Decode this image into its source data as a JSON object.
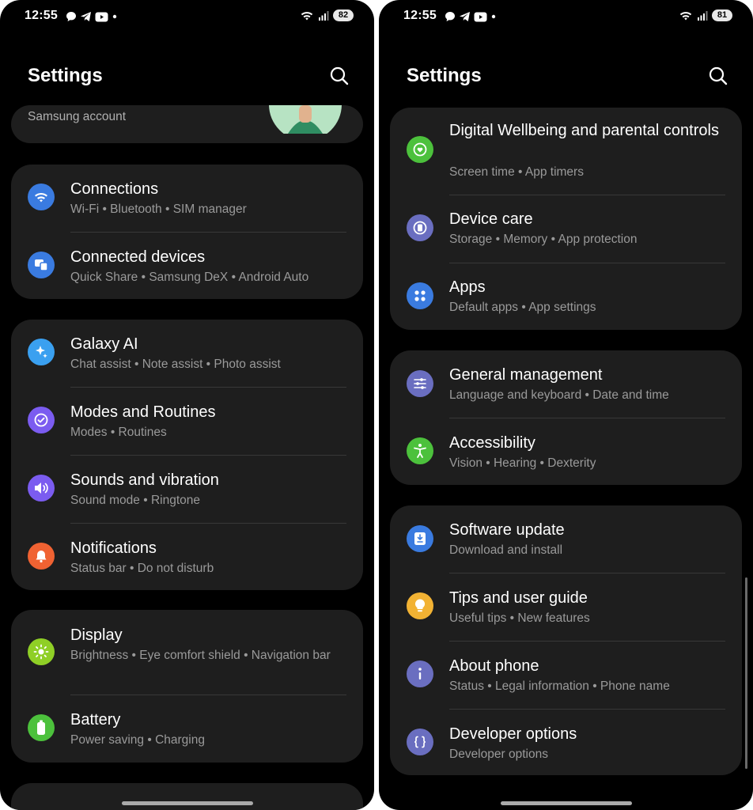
{
  "left": {
    "status": {
      "time": "12:55",
      "battery": "82"
    },
    "title": "Settings",
    "account": {
      "label": "Samsung account"
    },
    "group1": [
      {
        "title": "Connections",
        "subtitle": "Wi-Fi  •  Bluetooth  •  SIM manager",
        "icon": "wifi-icon",
        "color": "#3a7be0"
      },
      {
        "title": "Connected devices",
        "subtitle": "Quick Share  •  Samsung DeX  •  Android Auto",
        "icon": "connected-devices-icon",
        "color": "#3a7be0"
      }
    ],
    "group2": [
      {
        "title": "Galaxy AI",
        "subtitle": "Chat assist  •  Note assist  •  Photo assist",
        "icon": "sparkle-icon",
        "color": "#3aa0f0"
      },
      {
        "title": "Modes and Routines",
        "subtitle": "Modes  •  Routines",
        "icon": "routine-check-icon",
        "color": "#7b5cf0"
      },
      {
        "title": "Sounds and vibration",
        "subtitle": "Sound mode  •  Ringtone",
        "icon": "speaker-icon",
        "color": "#7b5cf0"
      },
      {
        "title": "Notifications",
        "subtitle": "Status bar  •  Do not disturb",
        "icon": "bell-icon",
        "color": "#f06232"
      }
    ],
    "group3": [
      {
        "title": "Display",
        "subtitle": "Brightness  •  Eye comfort shield  •  Navigation bar",
        "icon": "sun-icon",
        "color": "#8fcf26"
      },
      {
        "title": "Battery",
        "subtitle": "Power saving  •  Charging",
        "icon": "battery-icon",
        "color": "#4cc13c"
      }
    ]
  },
  "right": {
    "status": {
      "time": "12:55",
      "battery": "81"
    },
    "title": "Settings",
    "group1": [
      {
        "title": "Digital Wellbeing and parental controls",
        "subtitle": "Screen time  •  App timers",
        "icon": "wellbeing-heart-icon",
        "color": "#4cc13c"
      },
      {
        "title": "Device care",
        "subtitle": "Storage  •  Memory  •  App protection",
        "icon": "device-care-icon",
        "color": "#6a6ec0"
      },
      {
        "title": "Apps",
        "subtitle": "Default apps  •  App settings",
        "icon": "apps-grid-icon",
        "color": "#3a7be0"
      }
    ],
    "group2": [
      {
        "title": "General management",
        "subtitle": "Language and keyboard  •  Date and time",
        "icon": "sliders-icon",
        "color": "#6a6ec0"
      },
      {
        "title": "Accessibility",
        "subtitle": "Vision  •  Hearing  •  Dexterity",
        "icon": "accessibility-icon",
        "color": "#4cc13c"
      }
    ],
    "group3": [
      {
        "title": "Software update",
        "subtitle": "Download and install",
        "icon": "software-update-icon",
        "color": "#3a7be0"
      },
      {
        "title": "Tips and user guide",
        "subtitle": "Useful tips  •  New features",
        "icon": "lightbulb-icon",
        "color": "#f2b233"
      },
      {
        "title": "About phone",
        "subtitle": "Status  •  Legal information  •  Phone name",
        "icon": "info-icon",
        "color": "#6a6ec0"
      },
      {
        "title": "Developer options",
        "subtitle": "Developer options",
        "icon": "braces-icon",
        "color": "#6a6ec0"
      }
    ]
  }
}
